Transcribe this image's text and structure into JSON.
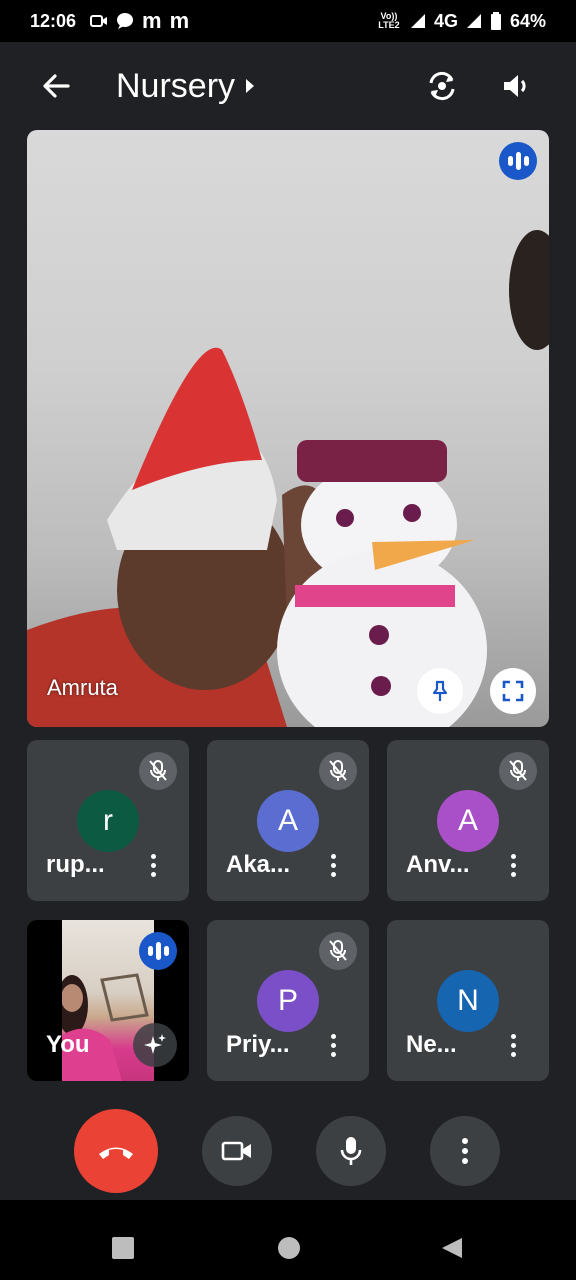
{
  "status_bar": {
    "time": "12:06",
    "left_icons": [
      "camera-icon",
      "chat-bubble-icon",
      "m-icon",
      "m-icon"
    ],
    "letters": [
      "m",
      "m"
    ],
    "volte": "Vo)) LTE2",
    "network": "4G",
    "battery": "64%"
  },
  "header": {
    "title": "Nursery"
  },
  "main_tile": {
    "name": "Amruta"
  },
  "participants": [
    {
      "name": "rup...",
      "initial": "r",
      "color": "#0d5a43",
      "muted": true
    },
    {
      "name": "Aka...",
      "initial": "A",
      "color": "#5b6dd1",
      "muted": true
    },
    {
      "name": "Anv...",
      "initial": "A",
      "color": "#a94fc7",
      "muted": true
    },
    {
      "name": "You",
      "self": true
    },
    {
      "name": "Priy...",
      "initial": "P",
      "color": "#7a4fc8",
      "muted": true
    },
    {
      "name": "Ne...",
      "initial": "N",
      "color": "#1565b0",
      "muted": false
    }
  ],
  "colors": {
    "background": "#202124",
    "tile": "#3c4043",
    "end_call": "#ea4335",
    "control": "#3c4043",
    "speaking": "#1a57c8"
  }
}
